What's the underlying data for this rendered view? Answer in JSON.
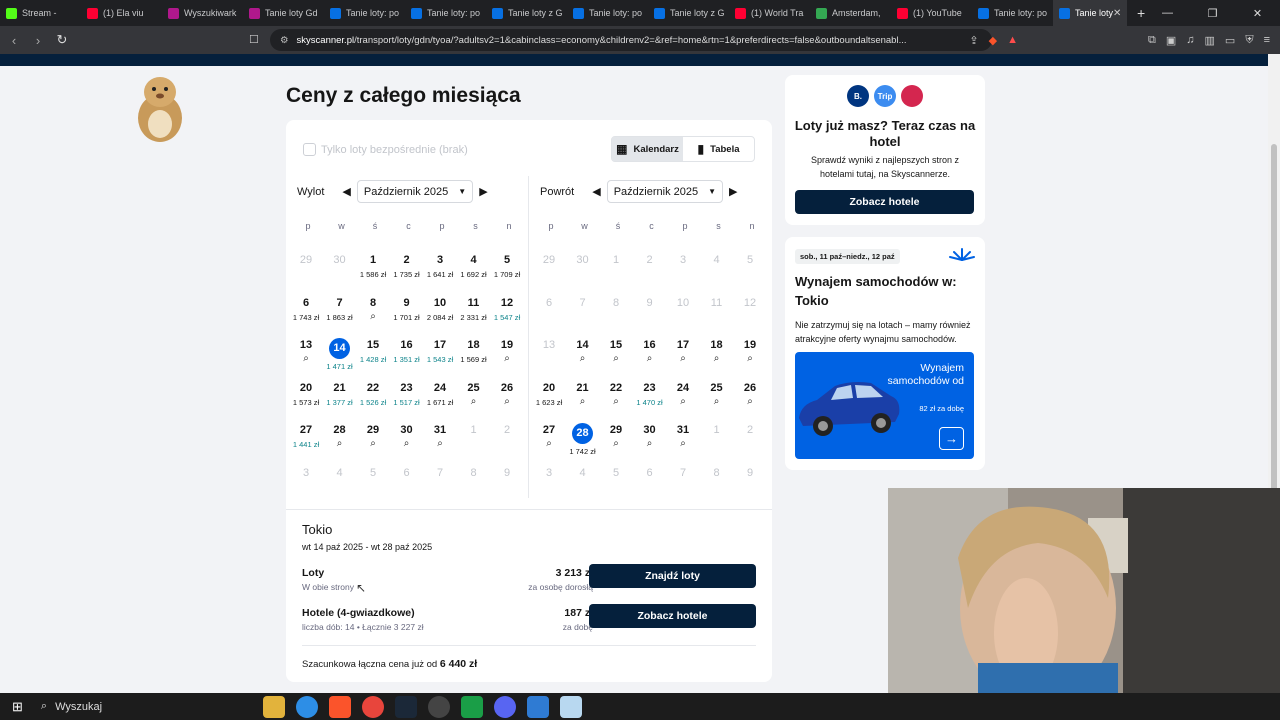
{
  "browser": {
    "tabs": [
      {
        "title": "Stream - ",
        "color": "#53fc18"
      },
      {
        "title": "(1) Ela viu",
        "color": "#ff0033"
      },
      {
        "title": "Wyszukiwark",
        "color": "#b0188c"
      },
      {
        "title": "Tanie loty Gd",
        "color": "#b0188c"
      },
      {
        "title": "Tanie loty: po",
        "color": "#0770e3"
      },
      {
        "title": "Tanie loty: po",
        "color": "#0770e3"
      },
      {
        "title": "Tanie loty z G",
        "color": "#0770e3"
      },
      {
        "title": "Tanie loty: po",
        "color": "#0770e3"
      },
      {
        "title": "Tanie loty z G",
        "color": "#0770e3"
      },
      {
        "title": "(1) World Tra",
        "color": "#ff0033"
      },
      {
        "title": "Amsterdam,",
        "color": "#34a853"
      },
      {
        "title": "(1) YouTube",
        "color": "#ff0033"
      },
      {
        "title": "Tanie loty: po",
        "color": "#0770e3"
      }
    ],
    "active_tab": "Tanie loty",
    "url_host": "skyscanner.pl",
    "url_rest": "/transport/loty/gdn/tyoa/?adultsv2=1&cabinclass=economy&childrenv2=&ref=home&rtn=1&preferdirects=false&outboundaltsenabl..."
  },
  "page": {
    "title": "Ceny z całego miesiąca",
    "direct_only": "Tylko loty bezpośrednie (brak)",
    "view_calendar": "Kalendarz",
    "view_table": "Tabela",
    "weekdays": [
      "p",
      "w",
      "ś",
      "c",
      "p",
      "s",
      "n"
    ],
    "outbound": {
      "label": "Wylot",
      "month": "Październik 2025",
      "days": [
        {
          "n": "29",
          "off": true
        },
        {
          "n": "30",
          "off": true
        },
        {
          "n": "1",
          "p": "1 586 zł"
        },
        {
          "n": "2",
          "p": "1 735 zł"
        },
        {
          "n": "3",
          "p": "1 641 zł"
        },
        {
          "n": "4",
          "p": "1 692 zł"
        },
        {
          "n": "5",
          "p": "1 709 zł"
        },
        {
          "n": "6",
          "p": "1 743 zł"
        },
        {
          "n": "7",
          "p": "1 863 zł"
        },
        {
          "n": "8",
          "q": true
        },
        {
          "n": "9",
          "p": "1 701 zł"
        },
        {
          "n": "10",
          "p": "2 084 zł"
        },
        {
          "n": "11",
          "p": "2 331 zł"
        },
        {
          "n": "12",
          "p": "1 547 zł",
          "g": true
        },
        {
          "n": "13",
          "q": true
        },
        {
          "n": "14",
          "p": "1 471 zł",
          "g": true,
          "sel": true
        },
        {
          "n": "15",
          "p": "1 428 zł",
          "g": true
        },
        {
          "n": "16",
          "p": "1 351 zł",
          "g": true
        },
        {
          "n": "17",
          "p": "1 543 zł",
          "g": true
        },
        {
          "n": "18",
          "p": "1 569 zł"
        },
        {
          "n": "19",
          "q": true
        },
        {
          "n": "20",
          "p": "1 573 zł"
        },
        {
          "n": "21",
          "p": "1 377 zł",
          "g": true
        },
        {
          "n": "22",
          "p": "1 526 zł",
          "g": true
        },
        {
          "n": "23",
          "p": "1 517 zł",
          "g": true
        },
        {
          "n": "24",
          "p": "1 671 zł"
        },
        {
          "n": "25",
          "q": true
        },
        {
          "n": "26",
          "q": true
        },
        {
          "n": "27",
          "p": "1 441 zł",
          "g": true
        },
        {
          "n": "28",
          "q": true
        },
        {
          "n": "29",
          "q": true
        },
        {
          "n": "30",
          "q": true
        },
        {
          "n": "31",
          "q": true
        },
        {
          "n": "1",
          "off": true
        },
        {
          "n": "2",
          "off": true
        },
        {
          "n": "3",
          "off": true
        },
        {
          "n": "4",
          "off": true
        },
        {
          "n": "5",
          "off": true
        },
        {
          "n": "6",
          "off": true
        },
        {
          "n": "7",
          "off": true
        },
        {
          "n": "8",
          "off": true
        },
        {
          "n": "9",
          "off": true
        }
      ]
    },
    "inbound": {
      "label": "Powrót",
      "month": "Październik 2025",
      "days": [
        {
          "n": "29",
          "off": true
        },
        {
          "n": "30",
          "off": true
        },
        {
          "n": "1",
          "off": true
        },
        {
          "n": "2",
          "off": true
        },
        {
          "n": "3",
          "off": true
        },
        {
          "n": "4",
          "off": true
        },
        {
          "n": "5",
          "off": true
        },
        {
          "n": "6",
          "off": true
        },
        {
          "n": "7",
          "off": true
        },
        {
          "n": "8",
          "off": true
        },
        {
          "n": "9",
          "off": true
        },
        {
          "n": "10",
          "off": true
        },
        {
          "n": "11",
          "off": true
        },
        {
          "n": "12",
          "off": true
        },
        {
          "n": "13",
          "off": true
        },
        {
          "n": "14",
          "q": true
        },
        {
          "n": "15",
          "q": true
        },
        {
          "n": "16",
          "q": true
        },
        {
          "n": "17",
          "q": true
        },
        {
          "n": "18",
          "q": true
        },
        {
          "n": "19",
          "q": true
        },
        {
          "n": "20",
          "p": "1 623 zł"
        },
        {
          "n": "21",
          "q": true
        },
        {
          "n": "22",
          "q": true
        },
        {
          "n": "23",
          "p": "1 470 zł",
          "g": true
        },
        {
          "n": "24",
          "q": true
        },
        {
          "n": "25",
          "q": true
        },
        {
          "n": "26",
          "q": true
        },
        {
          "n": "27",
          "q": true
        },
        {
          "n": "28",
          "p": "1 742 zł",
          "sel": true
        },
        {
          "n": "29",
          "q": true
        },
        {
          "n": "30",
          "q": true
        },
        {
          "n": "31",
          "q": true
        },
        {
          "n": "1",
          "off": true
        },
        {
          "n": "2",
          "off": true
        },
        {
          "n": "3",
          "off": true
        },
        {
          "n": "4",
          "off": true
        },
        {
          "n": "5",
          "off": true
        },
        {
          "n": "6",
          "off": true
        },
        {
          "n": "7",
          "off": true
        },
        {
          "n": "8",
          "off": true
        },
        {
          "n": "9",
          "off": true
        }
      ]
    },
    "summary": {
      "city": "Tokio",
      "dates": "wt 14 paź 2025 - wt 28 paź 2025",
      "flights_label": "Loty",
      "flights_sub": "W obie strony",
      "flights_price": "3 213 zł",
      "flights_price_sub": "za osobę dorosłą",
      "flights_button": "Znajdź loty",
      "hotels_label": "Hotele (4-gwiazdkowe)",
      "hotels_sub": "liczba dób: 14 • Łącznie 3 227 zł",
      "hotels_price": "187 zł",
      "hotels_price_sub": "za dobę",
      "hotels_button": "Zobacz hotele",
      "estimate_text": "Szacunkowa łączna cena już od",
      "estimate_value": "6 440 zł"
    }
  },
  "sidebar": {
    "hotel_card": {
      "logos": [
        {
          "text": "B.",
          "color": "#003580"
        },
        {
          "text": "Trip",
          "color": "#3c8cf0"
        },
        {
          "text": "",
          "color": "#d4264f"
        }
      ],
      "title": "Loty już masz? Teraz czas na hotel",
      "text": "Sprawdź wyniki z najlepszych stron z hotelami tutaj, na Skyscannerze.",
      "button": "Zobacz hotele"
    },
    "car_card": {
      "badge": "sob., 11 paź–niedz., 12 paź",
      "title": "Wynajem samochodów w: Tokio",
      "text": "Nie zatrzymuj się na lotach – mamy również atrakcyjne oferty wynajmu samochodów.",
      "promo_title": "Wynajem samochodów od",
      "promo_price": "82 zł za dobę"
    }
  },
  "taskbar": {
    "search": "Wyszukaj"
  }
}
